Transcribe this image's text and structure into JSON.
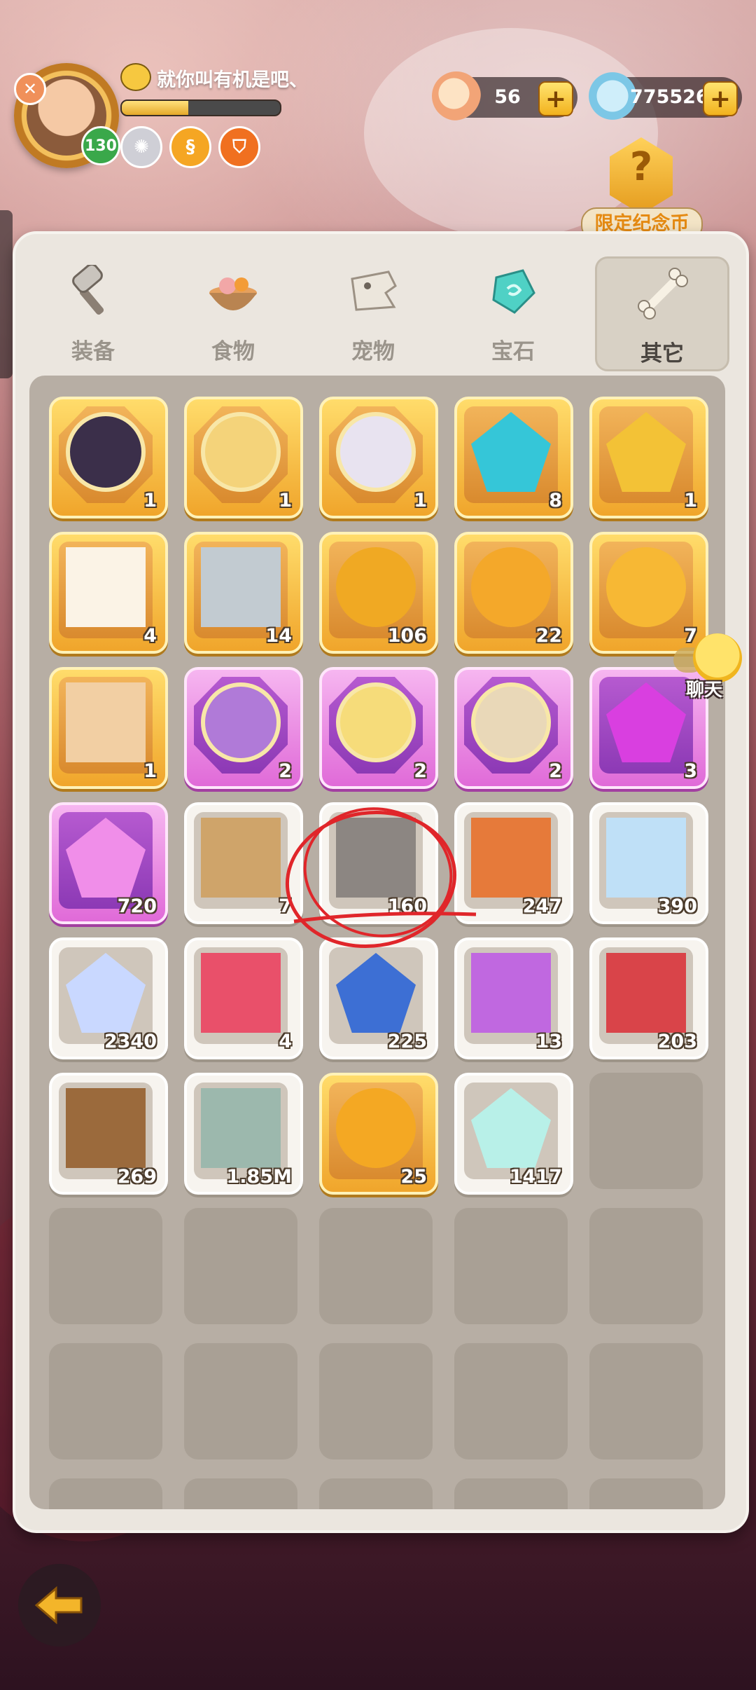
{
  "player": {
    "name": "就你叫有机是吧、",
    "level": "130",
    "xp_fraction": 0.42
  },
  "currencies": {
    "shells": "56",
    "crystals": "775526"
  },
  "limited_coin": {
    "label": "限定纪念币"
  },
  "tabs": [
    {
      "label": "装备"
    },
    {
      "label": "食物"
    },
    {
      "label": "宠物"
    },
    {
      "label": "宝石"
    },
    {
      "label": "其它"
    }
  ],
  "active_tab": "其它",
  "chat": {
    "label": "聊天"
  },
  "items": [
    {
      "qty": "1",
      "rarity": "gold",
      "shape": "hex",
      "icon": "dark-elf-portrait"
    },
    {
      "qty": "1",
      "rarity": "gold",
      "shape": "hex",
      "icon": "blonde-hero-portrait"
    },
    {
      "qty": "1",
      "rarity": "gold",
      "shape": "hex",
      "icon": "white-hair-portrait"
    },
    {
      "qty": "8",
      "rarity": "gold",
      "shape": "square",
      "icon": "blue-gem-icon"
    },
    {
      "qty": "1",
      "rarity": "gold",
      "shape": "square",
      "icon": "gold-ore-icon"
    },
    {
      "qty": "4",
      "rarity": "gold",
      "shape": "square",
      "icon": "dice-icon"
    },
    {
      "qty": "14",
      "rarity": "gold",
      "shape": "square",
      "icon": "magnifier-icon"
    },
    {
      "qty": "106",
      "rarity": "gold",
      "shape": "square",
      "icon": "cake-coin-icon"
    },
    {
      "qty": "22",
      "rarity": "gold",
      "shape": "square",
      "icon": "spiral-coin-icon"
    },
    {
      "qty": "7",
      "rarity": "gold",
      "shape": "square",
      "icon": "gold-egg-icon"
    },
    {
      "qty": "1",
      "rarity": "gold",
      "shape": "square",
      "icon": "caveman-icon"
    },
    {
      "qty": "2",
      "rarity": "purple",
      "shape": "hex",
      "icon": "purple-hair-portrait"
    },
    {
      "qty": "2",
      "rarity": "purple",
      "shape": "hex",
      "icon": "blonde-girl-portrait"
    },
    {
      "qty": "2",
      "rarity": "purple",
      "shape": "hex",
      "icon": "tribal-girl-portrait"
    },
    {
      "qty": "3",
      "rarity": "purple",
      "shape": "square",
      "icon": "purple-crystal-icon"
    },
    {
      "qty": "720",
      "rarity": "purple",
      "shape": "square",
      "icon": "pink-crystals-icon"
    },
    {
      "qty": "7",
      "rarity": "white",
      "shape": "square",
      "icon": "scroll-map-icon"
    },
    {
      "qty": "160",
      "rarity": "white",
      "shape": "square",
      "icon": "stone-tablet-icon"
    },
    {
      "qty": "247",
      "rarity": "white",
      "shape": "square",
      "icon": "food-tray-icon"
    },
    {
      "qty": "390",
      "rarity": "white",
      "shape": "square",
      "icon": "moon-icon"
    },
    {
      "qty": "2340",
      "rarity": "white",
      "shape": "square",
      "icon": "star-crystal-icon"
    },
    {
      "qty": "4",
      "rarity": "white",
      "shape": "square",
      "icon": "rose-icon"
    },
    {
      "qty": "225",
      "rarity": "white",
      "shape": "square",
      "icon": "blue-rune-icon"
    },
    {
      "qty": "13",
      "rarity": "white",
      "shape": "square",
      "icon": "purple-card-icon"
    },
    {
      "qty": "203",
      "rarity": "white",
      "shape": "square",
      "icon": "red-card-icon"
    },
    {
      "qty": "269",
      "rarity": "white",
      "shape": "square",
      "icon": "brown-card-icon"
    },
    {
      "qty": "1.85M",
      "rarity": "white",
      "shape": "square",
      "icon": "spiral-stone-icon"
    },
    {
      "qty": "25",
      "rarity": "gold",
      "shape": "square",
      "icon": "rune-coin-icon"
    },
    {
      "qty": "1417",
      "rarity": "white",
      "shape": "square",
      "icon": "rainbow-gem-icon"
    }
  ],
  "colors": {
    "gold": "#f0a52b",
    "purple": "#e06ad8",
    "white": "#f7f4ef",
    "annotation": "#e0262a"
  }
}
